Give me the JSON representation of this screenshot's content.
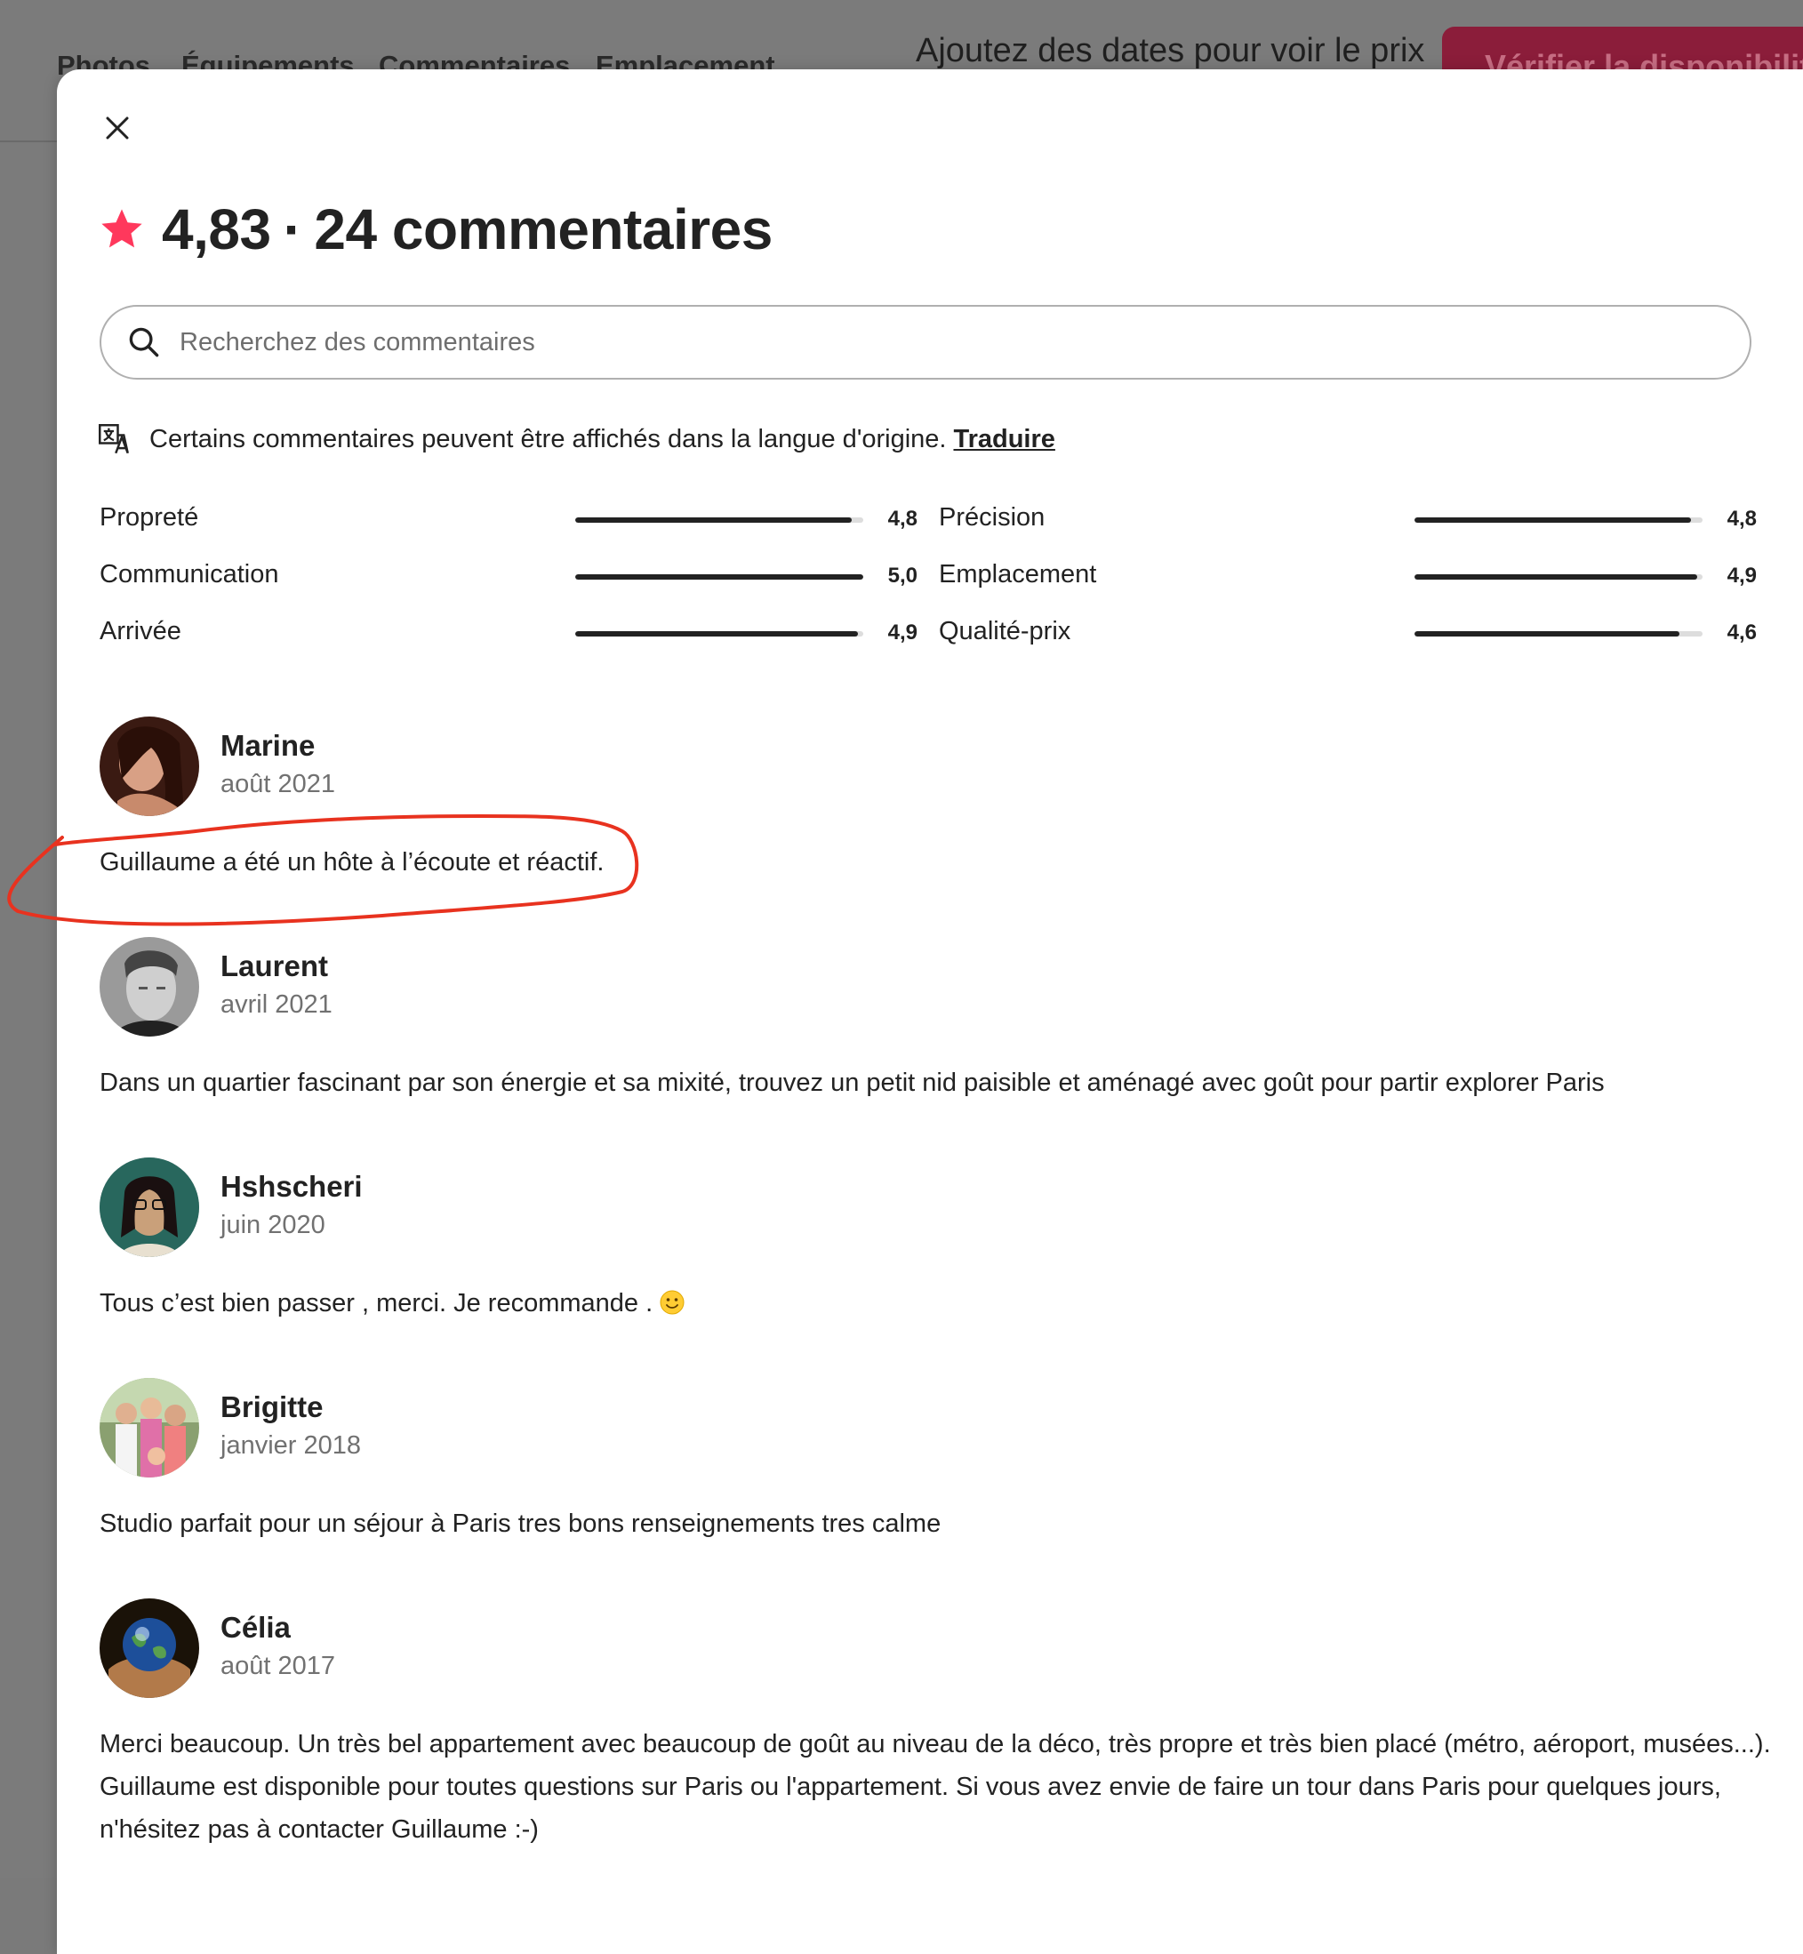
{
  "background": {
    "nav_links": [
      "Photos",
      "Équipements",
      "Commentaires",
      "Emplacement"
    ],
    "price_hint": "Ajoutez des dates pour voir le prix",
    "cta_label": "Vérifier la disponibilité"
  },
  "modal": {
    "rating": "4,83",
    "separator": "·",
    "review_count_label": "24 commentaires",
    "search": {
      "placeholder": "Recherchez des commentaires",
      "value": ""
    },
    "translate_notice": "Certains commentaires peuvent être affichés dans la langue d'origine.",
    "translate_link": "Traduire",
    "ratings": [
      {
        "label": "Propreté",
        "value": "4,8",
        "score": 4.8
      },
      {
        "label": "Précision",
        "value": "4,8",
        "score": 4.8
      },
      {
        "label": "Communication",
        "value": "5,0",
        "score": 5.0
      },
      {
        "label": "Emplacement",
        "value": "4,9",
        "score": 4.9
      },
      {
        "label": "Arrivée",
        "value": "4,9",
        "score": 4.9
      },
      {
        "label": "Qualité-prix",
        "value": "4,6",
        "score": 4.6
      }
    ],
    "reviews": [
      {
        "name": "Marine",
        "date": "août 2021",
        "text": "Guillaume a été un hôte à l’écoute et réactif."
      },
      {
        "name": "Laurent",
        "date": "avril 2021",
        "text": "Dans un quartier fascinant par son énergie et sa mixité, trouvez un petit nid paisible et aménagé avec goût pour partir explorer Paris"
      },
      {
        "name": "Hshscheri",
        "date": "juin 2020",
        "text": "Tous c’est bien passer , merci. Je recommande ."
      },
      {
        "name": "Brigitte",
        "date": "janvier 2018",
        "text": "Studio parfait pour un séjour à Paris tres bons renseignements tres calme"
      },
      {
        "name": "Célia",
        "date": "août 2017",
        "text": "Merci beaucoup. Un très bel appartement avec beaucoup de goût au niveau de la déco, très propre et très bien placé (métro, aéroport, musées...). Guillaume est disponible pour toutes questions sur Paris ou l'appartement. Si vous avez envie de faire un tour dans Paris pour quelques jours, n'hésitez pas à contacter Guillaume :-)"
      }
    ]
  },
  "colors": {
    "brand": "#ff385c",
    "text": "#222222",
    "muted": "#717171",
    "annotation": "#e8321f"
  }
}
